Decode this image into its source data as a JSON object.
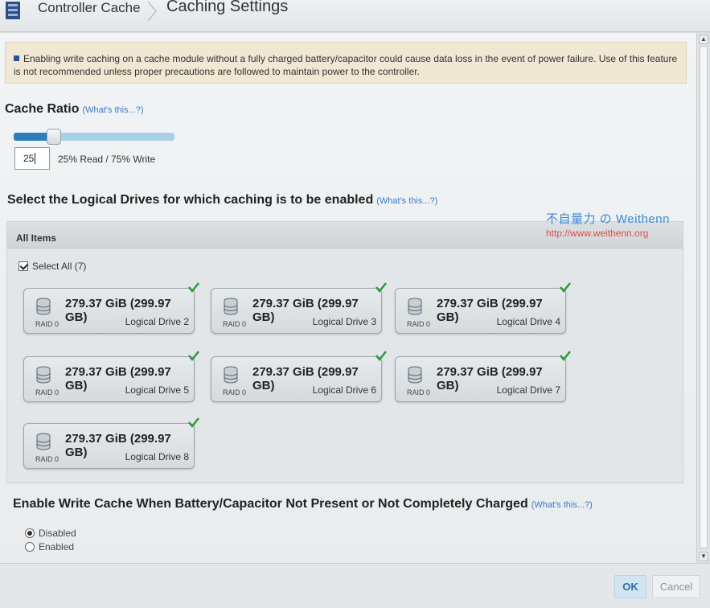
{
  "breadcrumb": {
    "item1": "Controller Cache",
    "item2": "Caching Settings"
  },
  "warning": {
    "text": "Enabling write caching on a cache module without a fully charged battery/capacitor could cause data loss in the event of power failure. Use of this feature is not recommended unless proper precautions are followed to maintain power to the controller."
  },
  "cache_ratio": {
    "title": "Cache Ratio",
    "help": "(What's this...?)",
    "value": "25",
    "read_percent": 25,
    "label": "25% Read / 75% Write"
  },
  "logical_drives": {
    "title": "Select the Logical Drives for which caching is to be enabled",
    "help": "(What's this...?)",
    "panel_header": "All Items",
    "select_all": "Select All (7)",
    "drives": [
      {
        "size": "279.37 GiB (299.97 GB)",
        "raid": "RAID 0",
        "name": "Logical Drive 2"
      },
      {
        "size": "279.37 GiB (299.97 GB)",
        "raid": "RAID 0",
        "name": "Logical Drive 3"
      },
      {
        "size": "279.37 GiB (299.97 GB)",
        "raid": "RAID 0",
        "name": "Logical Drive 4"
      },
      {
        "size": "279.37 GiB (299.97 GB)",
        "raid": "RAID 0",
        "name": "Logical Drive 5"
      },
      {
        "size": "279.37 GiB (299.97 GB)",
        "raid": "RAID 0",
        "name": "Logical Drive 6"
      },
      {
        "size": "279.37 GiB (299.97 GB)",
        "raid": "RAID 0",
        "name": "Logical Drive 7"
      },
      {
        "size": "279.37 GiB (299.97 GB)",
        "raid": "RAID 0",
        "name": "Logical Drive 8"
      }
    ]
  },
  "write_cache": {
    "title": "Enable Write Cache When Battery/Capacitor Not Present or Not Completely Charged",
    "help": "(What's this...?)",
    "options": [
      "Disabled",
      "Enabled"
    ],
    "selected": "Disabled"
  },
  "buttons": {
    "ok": "OK",
    "cancel": "Cancel"
  },
  "watermark": {
    "line1": "不自量力 の Weithenn",
    "line2": "http://www.weithenn.org"
  },
  "colors": {
    "accent": "#2e7db8",
    "link": "#3a7bd0",
    "check": "#2f9a3a",
    "warning_bg": "#f0e8d2"
  }
}
